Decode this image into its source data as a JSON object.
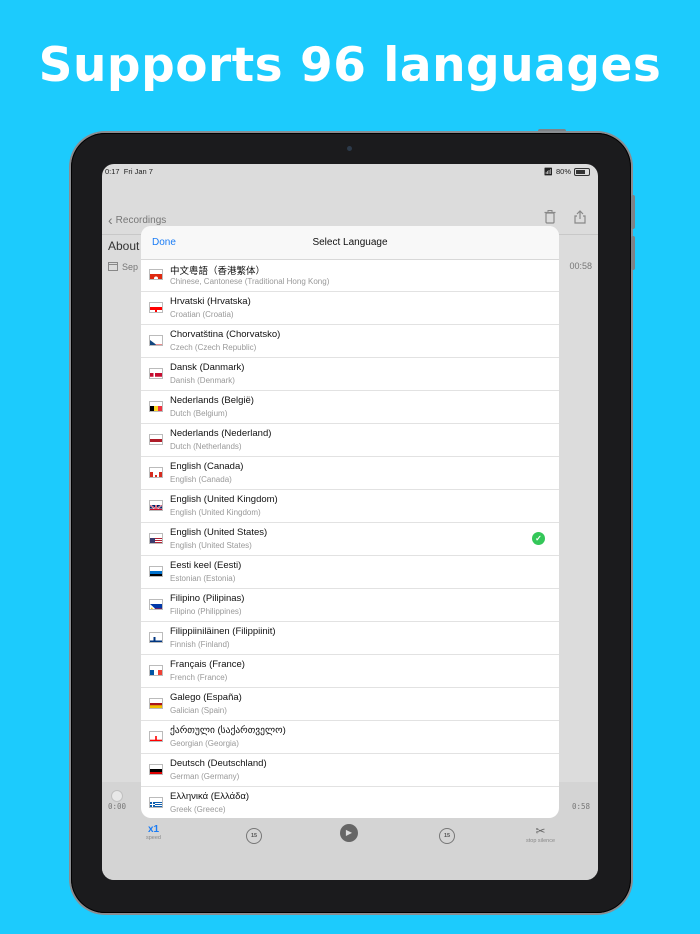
{
  "headline": "Supports 96 languages",
  "status_bar": {
    "time": "0:17",
    "date": "Fri Jan 7",
    "battery": "80%"
  },
  "nav": {
    "back_label": "Recordings"
  },
  "recording": {
    "title": "About",
    "date_prefix": "Sep",
    "duration": "00:58"
  },
  "player": {
    "elapsed": "0:00",
    "total": "0:58",
    "speed": "x1",
    "speed_label": "speed",
    "skip_back": "15",
    "skip_fwd": "15",
    "stop_silence_label": "stop silence"
  },
  "modal": {
    "done_label": "Done",
    "title": "Select Language",
    "languages": [
      {
        "name": "中文粵語（香港繁体）",
        "sub": "Chinese, Cantonese (Traditional Hong Kong)",
        "flag": "hk"
      },
      {
        "name": "Hrvatski (Hrvatska)",
        "sub": "Croatian (Croatia)",
        "flag": "hr"
      },
      {
        "name": "Chorvatština (Chorvatsko)",
        "sub": "Czech (Czech Republic)",
        "flag": "cz"
      },
      {
        "name": "Dansk (Danmark)",
        "sub": "Danish (Denmark)",
        "flag": "dk"
      },
      {
        "name": "Nederlands (België)",
        "sub": "Dutch (Belgium)",
        "flag": "be"
      },
      {
        "name": "Nederlands (Nederland)",
        "sub": "Dutch (Netherlands)",
        "flag": "nl"
      },
      {
        "name": "English (Canada)",
        "sub": "English (Canada)",
        "flag": "ca"
      },
      {
        "name": "English (United Kingdom)",
        "sub": "English (United Kingdom)",
        "flag": "gb"
      },
      {
        "name": "English (United States)",
        "sub": "English (United States)",
        "flag": "us",
        "selected": true
      },
      {
        "name": "Eesti keel (Eesti)",
        "sub": "Estonian (Estonia)",
        "flag": "ee"
      },
      {
        "name": "Filipino (Pilipinas)",
        "sub": "Filipino (Philippines)",
        "flag": "ph"
      },
      {
        "name": "Filippiiniläinen (Filippiinit)",
        "sub": "Finnish (Finland)",
        "flag": "fi"
      },
      {
        "name": "Français (France)",
        "sub": "French (France)",
        "flag": "fr"
      },
      {
        "name": "Galego (España)",
        "sub": "Galician (Spain)",
        "flag": "es"
      },
      {
        "name": "ქართული (საქართველო)",
        "sub": "Georgian (Georgia)",
        "flag": "ge"
      },
      {
        "name": "Deutsch (Deutschland)",
        "sub": "German (Germany)",
        "flag": "de"
      },
      {
        "name": "Ελληνικά (Ελλάδα)",
        "sub": "Greek (Greece)",
        "flag": "gr"
      }
    ]
  },
  "colors": {
    "background": "#1ccbfd",
    "accent": "#1a7cf5",
    "check": "#34c759"
  }
}
